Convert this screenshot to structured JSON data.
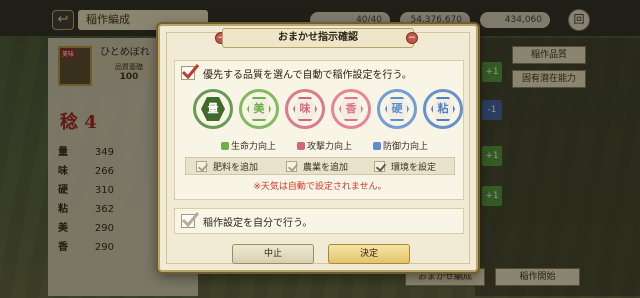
{
  "topbar": {
    "back_icon": "↩",
    "title": "稲作編成",
    "resources": [
      "40/40",
      "54,376,670",
      "434,060"
    ],
    "menu_icon": "回"
  },
  "left_panel": {
    "rice_card": "美味",
    "rice_name": "ひとめぼれ",
    "quality_base_label": "品質基礎",
    "quality_base_value": "100",
    "rank": "稔 4",
    "stats": [
      {
        "key": "量",
        "value": "349"
      },
      {
        "key": "味",
        "value": "266"
      },
      {
        "key": "硬",
        "value": "310"
      },
      {
        "key": "粘",
        "value": "362"
      },
      {
        "key": "美",
        "value": "290"
      },
      {
        "key": "香",
        "value": "290"
      }
    ]
  },
  "right_panel": {
    "buttons": [
      "稲作品質",
      "固有潜在能力"
    ],
    "slots": [
      "+1",
      "-1",
      "+1",
      "+1"
    ],
    "bottom_buttons": [
      "おまかせ編成",
      "稲作開始"
    ]
  },
  "modal": {
    "title": "おまかせ指示確認",
    "auto_label": "優先する品質を選んで自動で稲作設定を行う。",
    "qualities": [
      {
        "char": "量",
        "color": "#4f8a3a",
        "selected": true
      },
      {
        "char": "美",
        "color": "#6fae48",
        "selected": false
      },
      {
        "char": "味",
        "color": "#d6657a",
        "selected": false
      },
      {
        "char": "香",
        "color": "#e07386",
        "selected": false
      },
      {
        "char": "硬",
        "color": "#5a8fd0",
        "selected": false
      },
      {
        "char": "粘",
        "color": "#4d7fc8",
        "selected": false
      }
    ],
    "effects": [
      {
        "label": "生命力向上",
        "color": "#6fae48"
      },
      {
        "label": "攻撃力向上",
        "color": "#d6657a"
      },
      {
        "label": "防御力向上",
        "color": "#5a8fd0"
      }
    ],
    "sub_options": [
      {
        "label": "肥料を追加",
        "on": false
      },
      {
        "label": "農業を追加",
        "on": false
      },
      {
        "label": "環境を設定",
        "on": true
      }
    ],
    "note": "※天気は自動で設定されません。",
    "manual_label": "稲作設定を自分で行う。",
    "cancel_label": "中止",
    "ok_label": "決定"
  }
}
